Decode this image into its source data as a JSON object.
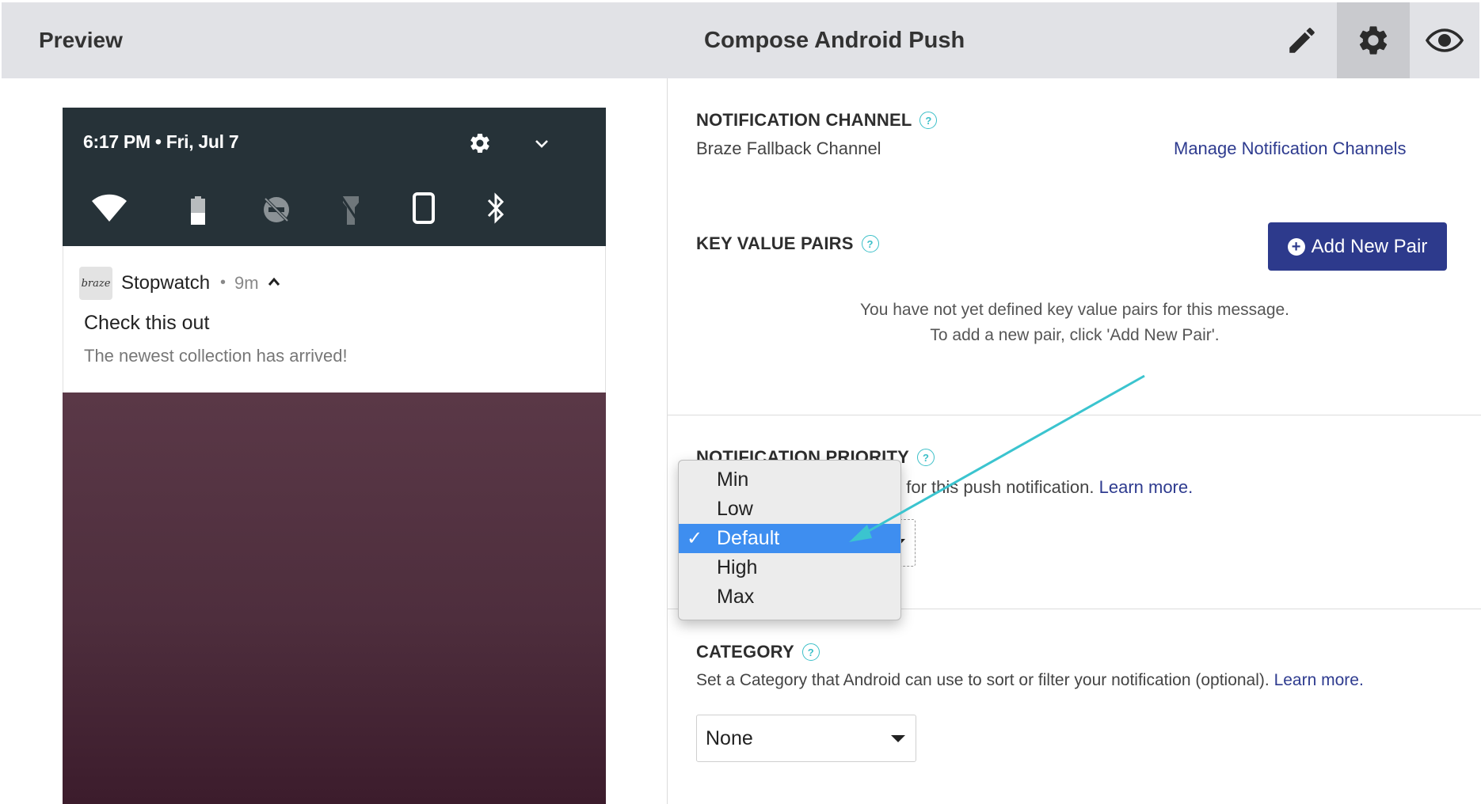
{
  "header": {
    "preview_label": "Preview",
    "title": "Compose Android Push",
    "icons": [
      "pencil-icon",
      "gear-icon",
      "eye-icon"
    ]
  },
  "phone": {
    "status_time": "6:17 PM • Fri, Jul 7",
    "quick_settings": [
      "wifi-icon",
      "battery-icon",
      "do-not-disturb-icon",
      "flashlight-icon",
      "rotation-icon",
      "bluetooth-icon"
    ],
    "notification": {
      "logo_text": "braze",
      "app_name": "Stopwatch",
      "separator": "•",
      "time_ago": "9m",
      "title": "Check this out",
      "body": "The newest collection has arrived!"
    }
  },
  "panel": {
    "notification_channel": {
      "label": "NOTIFICATION CHANNEL",
      "value": "Braze Fallback Channel",
      "manage_link": "Manage Notification Channels"
    },
    "key_value_pairs": {
      "label": "KEY VALUE PAIRS",
      "add_button": "Add New Pair",
      "empty_line1": "You have not yet defined key value pairs for this message.",
      "empty_line2": "To add a new pair, click 'Add New Pair'."
    },
    "priority": {
      "label": "NOTIFICATION PRIORITY",
      "desc_visible": "el for this push notification.",
      "learn_more": "Learn more."
    },
    "category": {
      "label": "CATEGORY",
      "desc": "Set a Category that Android can use to sort or filter your notification (optional).",
      "learn_more": "Learn more.",
      "selected": "None"
    },
    "help_glyph": "?"
  },
  "priority_dropdown": {
    "options": [
      "Min",
      "Low",
      "Default",
      "High",
      "Max"
    ],
    "selected_index": 2,
    "check_glyph": "✓"
  },
  "colors": {
    "header_bg": "#e1e2e6",
    "accent": "#2d3a8c",
    "help": "#3bbfc8",
    "annotation_arrow": "#3bc4cf",
    "selected_option": "#3e8ef0"
  }
}
